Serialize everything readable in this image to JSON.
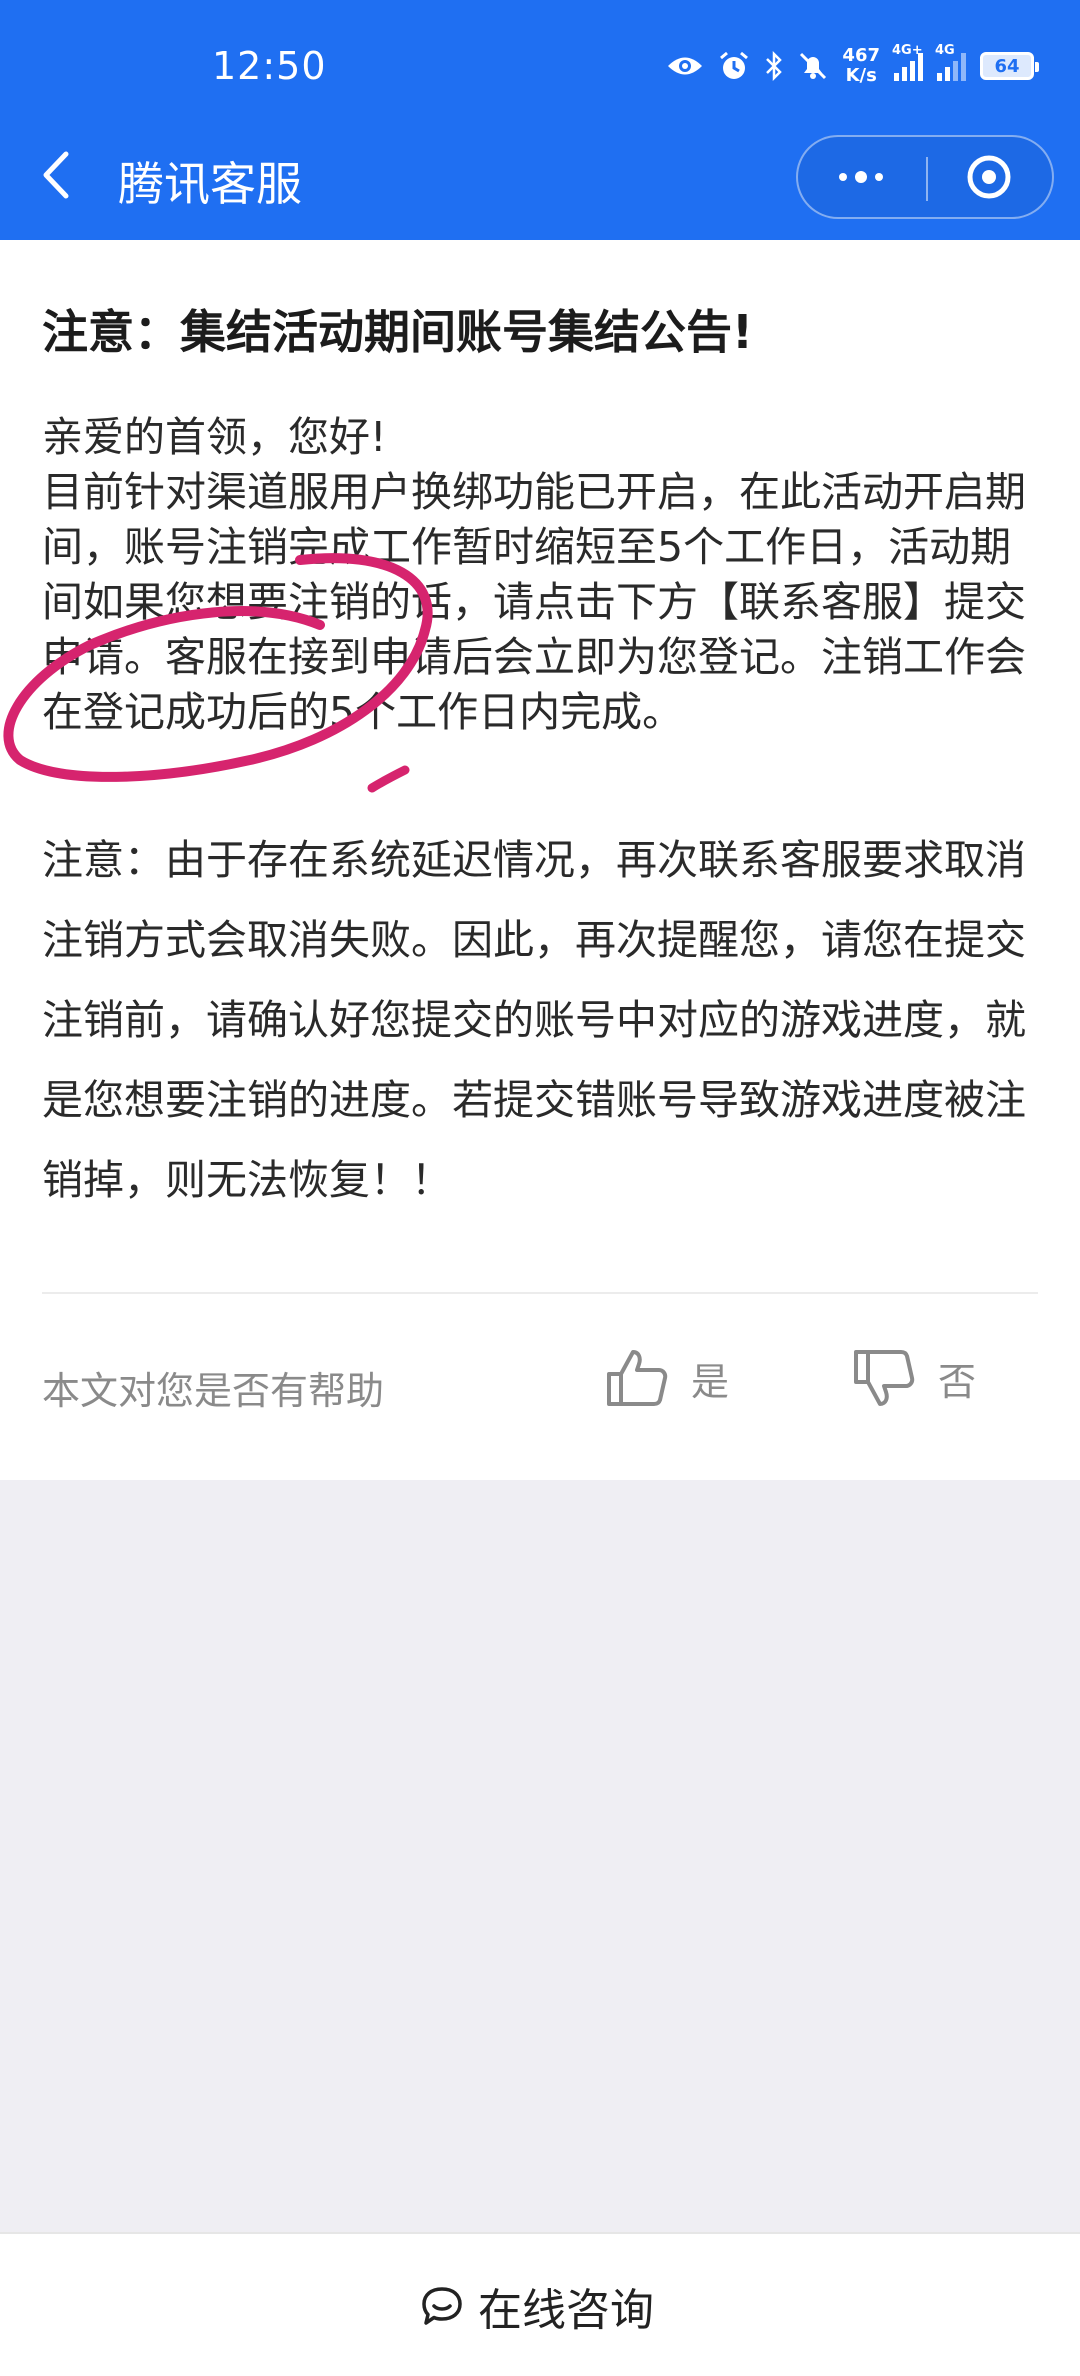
{
  "status_bar": {
    "time": "12:50",
    "net_speed_value": "467",
    "net_speed_unit": "K/s",
    "signal1_label": "4G+",
    "signal2_label": "4G",
    "battery": "64"
  },
  "header": {
    "title": "腾讯客服"
  },
  "article": {
    "title": "注意：集结活动期间账号集结公告!",
    "para1": "亲爱的首领，您好!\n目前针对渠道服用户换绑功能已开启，在此活动开启期间，账号注销完成工作暂时缩短至5个工作日，活动期间如果您想要注销的话，请点击下方【联系客服】提交申请。客服在接到申请后会立即为您登记。注销工作会在登记成功后的5个工作日内完成。",
    "para2": "注意：由于存在系统延迟情况，再次联系客服要求取消注销方式会取消失败。因此，再次提醒您，请您在提交注销前，请确认好您提交的账号中对应的游戏进度，就是您想要注销的进度。若提交错账号导致游戏进度被注销掉，则无法恢复！！"
  },
  "feedback": {
    "label": "本文对您是否有帮助",
    "yes": "是",
    "no": "否"
  },
  "bottom": {
    "consult_label": "在线咨询"
  },
  "colors": {
    "header_blue": "#1f6ff2",
    "annotation_pink": "#d6246e"
  }
}
